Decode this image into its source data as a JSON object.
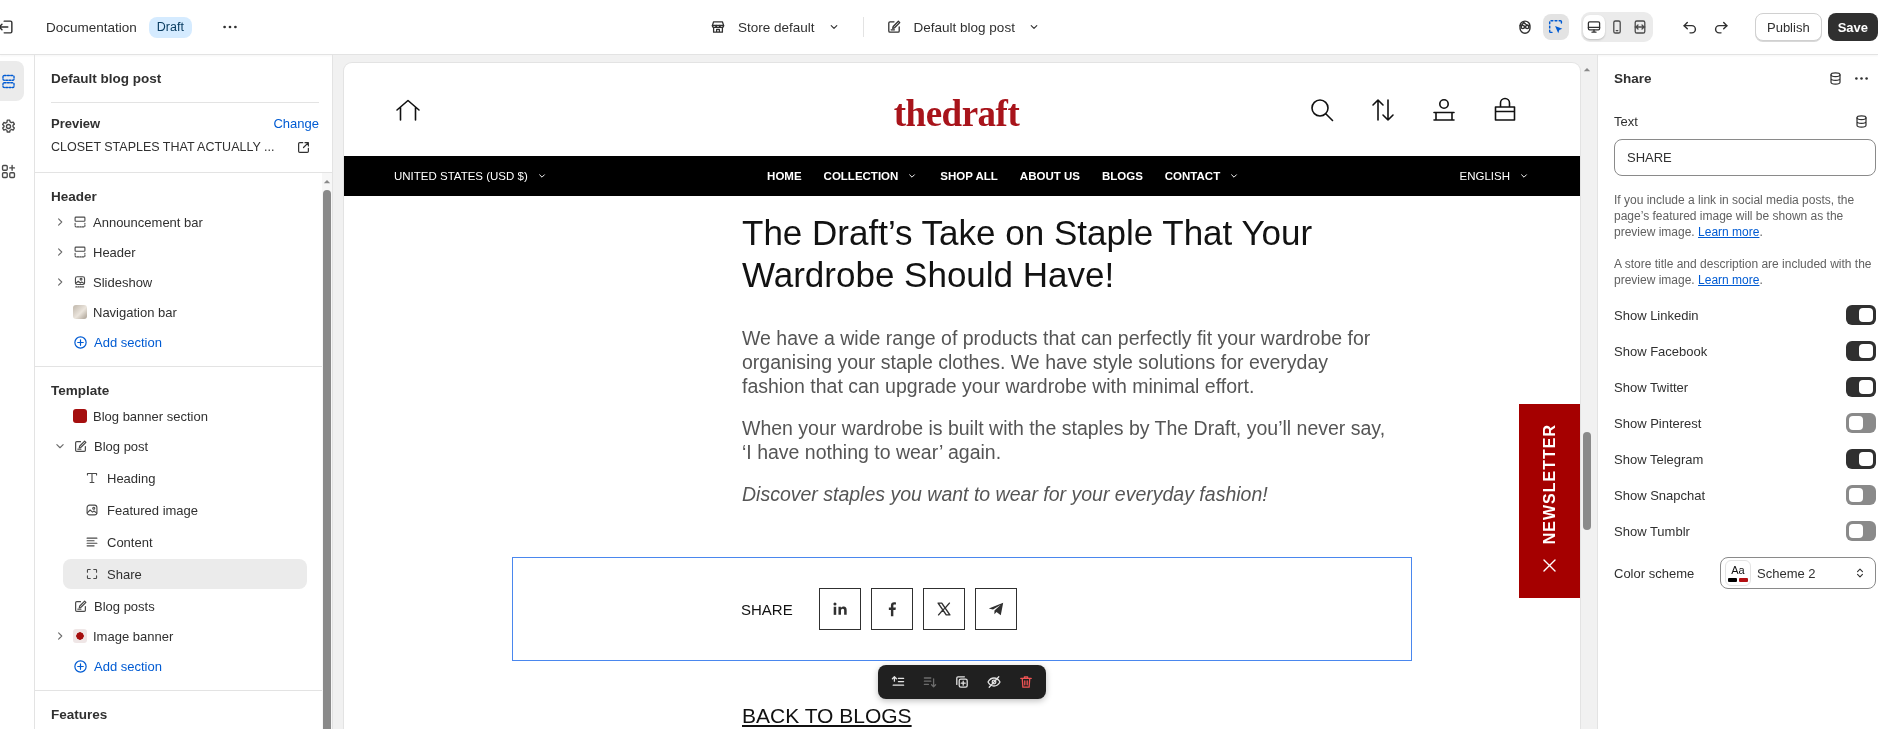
{
  "topbar": {
    "title": "Documentation",
    "badge": "Draft",
    "theme": "Store default",
    "template": "Default blog post",
    "tools": [
      {
        "kind": "sidekick",
        "selected": false
      },
      {
        "kind": "inspector",
        "selected": true
      }
    ],
    "devices": [
      {
        "kind": "desktop",
        "selected": true
      },
      {
        "kind": "mobile",
        "selected": false
      },
      {
        "kind": "full-width",
        "selected": false
      }
    ],
    "buttons": [
      {
        "label": "Publish",
        "kind": "publish"
      },
      {
        "label": "Save",
        "kind": "save"
      }
    ]
  },
  "rail": [
    {
      "kind": "sections",
      "selected": true
    },
    {
      "kind": "settings",
      "selected": false
    },
    {
      "kind": "apps",
      "selected": false
    }
  ],
  "sidebar": {
    "title": "Default blog post",
    "preview": {
      "label": "Preview",
      "action": "Change",
      "value": "CLOSET STAPLES THAT ACTUALLY ..."
    },
    "groups": [
      {
        "title": "Header",
        "items": [
          {
            "label": "Announcement bar",
            "kind": "section",
            "expanded": false,
            "selected": false
          },
          {
            "label": "Header",
            "kind": "section",
            "expanded": false,
            "selected": false
          },
          {
            "label": "Slideshow",
            "kind": "slideshow",
            "expanded": false,
            "selected": false
          },
          {
            "label": "Navigation bar",
            "kind": "thumbnail",
            "selected": false
          }
        ],
        "add": "Add section"
      },
      {
        "title": "Template",
        "items": [
          {
            "label": "Blog banner section",
            "kind": "swatch",
            "selected": false
          },
          {
            "label": "Blog post",
            "kind": "post",
            "expanded": true,
            "selected": false,
            "children": [
              {
                "label": "Heading",
                "kind": "heading",
                "selected": false
              },
              {
                "label": "Featured image",
                "kind": "image",
                "selected": false
              },
              {
                "label": "Content",
                "kind": "content",
                "selected": false
              },
              {
                "label": "Share",
                "kind": "block",
                "selected": true
              }
            ]
          },
          {
            "label": "Blog posts",
            "kind": "post",
            "selected": false
          },
          {
            "label": "Image banner",
            "kind": "logo-thumbnail",
            "expanded": false,
            "selected": false
          }
        ],
        "add": "Add section"
      },
      {
        "title": "Features"
      }
    ]
  },
  "store": {
    "logo": "thedraft",
    "currency": "UNITED STATES (USD $)",
    "menu": [
      {
        "label": "HOME",
        "dropdown": false
      },
      {
        "label": "COLLECTION",
        "dropdown": true
      },
      {
        "label": "SHOP ALL",
        "dropdown": false
      },
      {
        "label": "ABOUT US",
        "dropdown": false
      },
      {
        "label": "BLOGS",
        "dropdown": false
      },
      {
        "label": "CONTACT",
        "dropdown": true
      }
    ],
    "language": "ENGLISH",
    "article": {
      "title": "The Draft’s Take on Staple That Your Wardrobe Should Have!",
      "paragraphs": [
        {
          "kind": "plain",
          "text": "We have a wide range of products that can perfectly fit your wardrobe for organising your staple clothes. We have style solutions for everyday fashion that can upgrade your wardrobe with minimal effort."
        },
        {
          "kind": "plain",
          "text": "When your wardrobe is built with the staples by The Draft, you’ll never say, ‘I have nothing to wear’ again."
        },
        {
          "kind": "italic",
          "text": "Discover staples you want to wear for your everyday fashion!"
        }
      ]
    },
    "share": {
      "label": "SHARE",
      "selected": true,
      "buttons": [
        {
          "kind": "linkedin"
        },
        {
          "kind": "facebook"
        },
        {
          "kind": "x"
        },
        {
          "kind": "telegram"
        }
      ]
    },
    "block_toolbar": [
      {
        "kind": "move-up",
        "disabled": false
      },
      {
        "kind": "move-down",
        "disabled": true
      },
      {
        "kind": "duplicate",
        "disabled": false
      },
      {
        "kind": "hide",
        "disabled": false
      },
      {
        "kind": "delete",
        "disabled": false
      }
    ],
    "back_link": "BACK TO BLOGS",
    "newsletter": "NEWSLETTER"
  },
  "inspector": {
    "title": "Share",
    "text_field": {
      "label": "Text",
      "value": "SHARE"
    },
    "notes": [
      {
        "text": "If you include a link in social media posts, the page’s featured image will be shown as the preview image. ",
        "link": "Learn more",
        "after": "."
      },
      {
        "text": "A store title and description are included with the preview image. ",
        "link": "Learn more",
        "after": "."
      }
    ],
    "toggles": [
      {
        "label": "Show Linkedin",
        "on": true
      },
      {
        "label": "Show Facebook",
        "on": true
      },
      {
        "label": "Show Twitter",
        "on": true
      },
      {
        "label": "Show Pinterest",
        "on": false
      },
      {
        "label": "Show Telegram",
        "on": true
      },
      {
        "label": "Show Snapchat",
        "on": false
      },
      {
        "label": "Show Tumblr",
        "on": false
      }
    ],
    "color_scheme": {
      "label": "Color scheme",
      "swatch": "Aa",
      "value": "Scheme 2"
    }
  }
}
